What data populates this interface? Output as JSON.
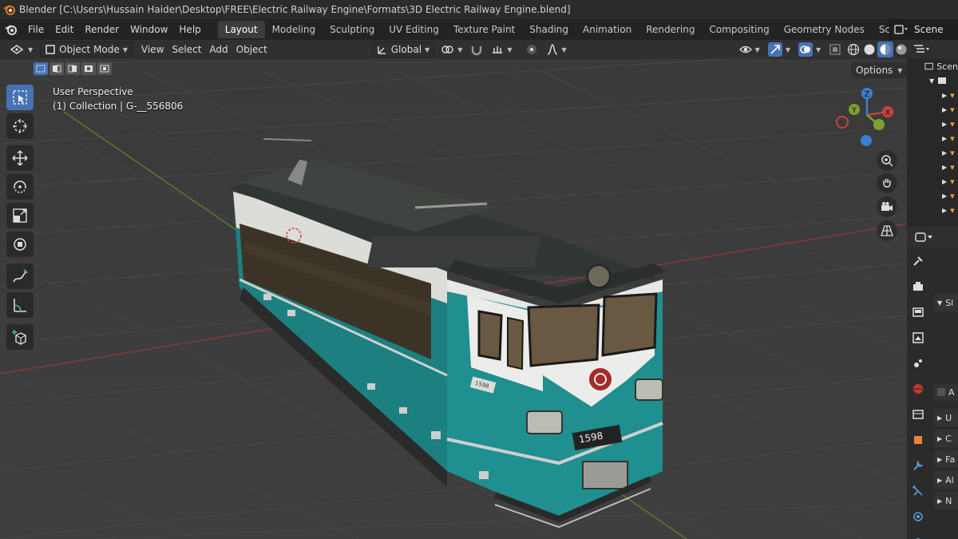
{
  "window": {
    "title": "Blender [C:\\Users\\Hussain Haider\\Desktop\\FREE\\Electric Railway Engine\\Formats\\3D Electric Railway Engine.blend]"
  },
  "menu": {
    "items": [
      "File",
      "Edit",
      "Render",
      "Window",
      "Help"
    ]
  },
  "workspaces": {
    "tabs": [
      "Layout",
      "Modeling",
      "Sculpting",
      "UV Editing",
      "Texture Paint",
      "Shading",
      "Animation",
      "Rendering",
      "Compositing",
      "Geometry Nodes",
      "Scripting"
    ],
    "active": "Layout",
    "add_label": "+"
  },
  "scene": {
    "label": "Scene"
  },
  "viewport_header": {
    "mode": "Object Mode",
    "menus": [
      "View",
      "Select",
      "Add",
      "Object"
    ],
    "transform_orientation": "Global",
    "options_label": "Options"
  },
  "viewport": {
    "view_name": "User Perspective",
    "collection_info": "(1) Collection | G-__556806"
  },
  "gizmo": {
    "x_label": "X",
    "y_label": "Y",
    "z_label": "Z"
  },
  "model": {
    "number_plate": "1598",
    "side_number": "1598"
  },
  "outliner": {
    "header_label": "Scen"
  },
  "properties": {
    "panels": [
      "Sl",
      "A",
      "U",
      "C",
      "Fa",
      "Al",
      "N"
    ]
  },
  "colors": {
    "accent": "#4772b3",
    "axis_x": "#c8433f",
    "axis_y": "#7ea02e",
    "axis_z": "#3a7fd1",
    "train_teal": "#1f8f8f"
  }
}
